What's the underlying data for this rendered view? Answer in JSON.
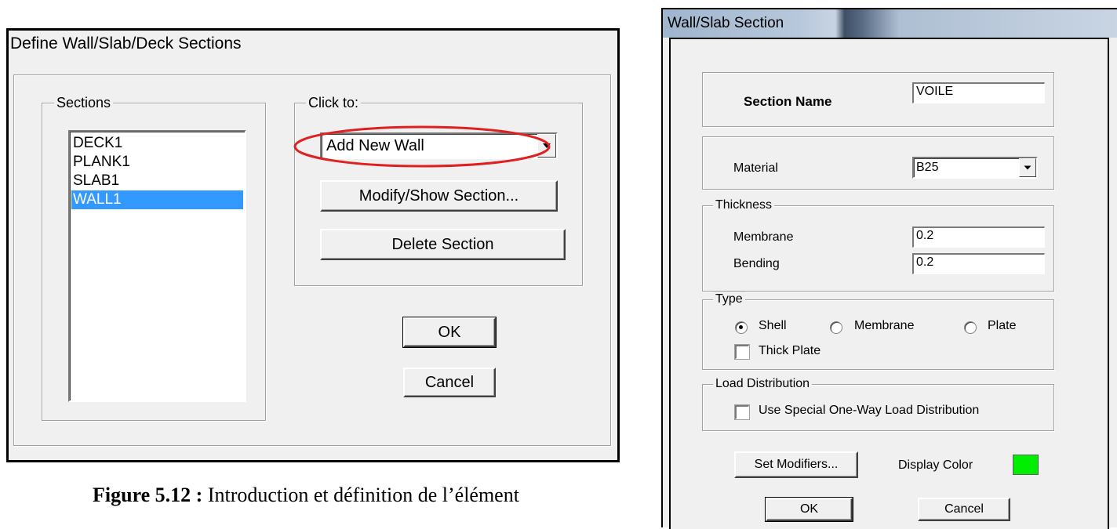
{
  "define_dialog": {
    "title": "Define Wall/Slab/Deck Sections",
    "sections_label": "Sections",
    "sections": [
      "DECK1",
      "PLANK1",
      "SLAB1",
      "WALL1"
    ],
    "selected_section": "WALL1",
    "click_to_label": "Click to:",
    "add_combo_value": "Add New Wall",
    "modify_button": "Modify/Show Section...",
    "delete_button": "Delete Section",
    "ok_button": "OK",
    "cancel_button": "Cancel",
    "highlight_color": "#e02020"
  },
  "section_dialog": {
    "title": "Wall/Slab Section",
    "section_name_label": "Section Name",
    "section_name_value": "VOILE",
    "material_label": "Material",
    "material_value": "B25",
    "thickness_label": "Thickness",
    "membrane_label": "Membrane",
    "membrane_value": "0.2",
    "bending_label": "Bending",
    "bending_value": "0.2",
    "type_label": "Type",
    "type_options": [
      "Shell",
      "Membrane",
      "Plate"
    ],
    "type_selected": "Shell",
    "thick_plate_label": "Thick Plate",
    "thick_plate_checked": false,
    "load_distribution_label": "Load Distribution",
    "one_way_label": "Use Special One-Way Load Distribution",
    "one_way_checked": false,
    "set_modifiers_button": "Set Modifiers...",
    "display_color_label": "Display Color",
    "display_color": "#00ee00",
    "ok_button": "OK",
    "cancel_button": "Cancel"
  },
  "caption": {
    "label": "Figure 5.12 :",
    "text": "Introduction et définition de l’élément"
  }
}
